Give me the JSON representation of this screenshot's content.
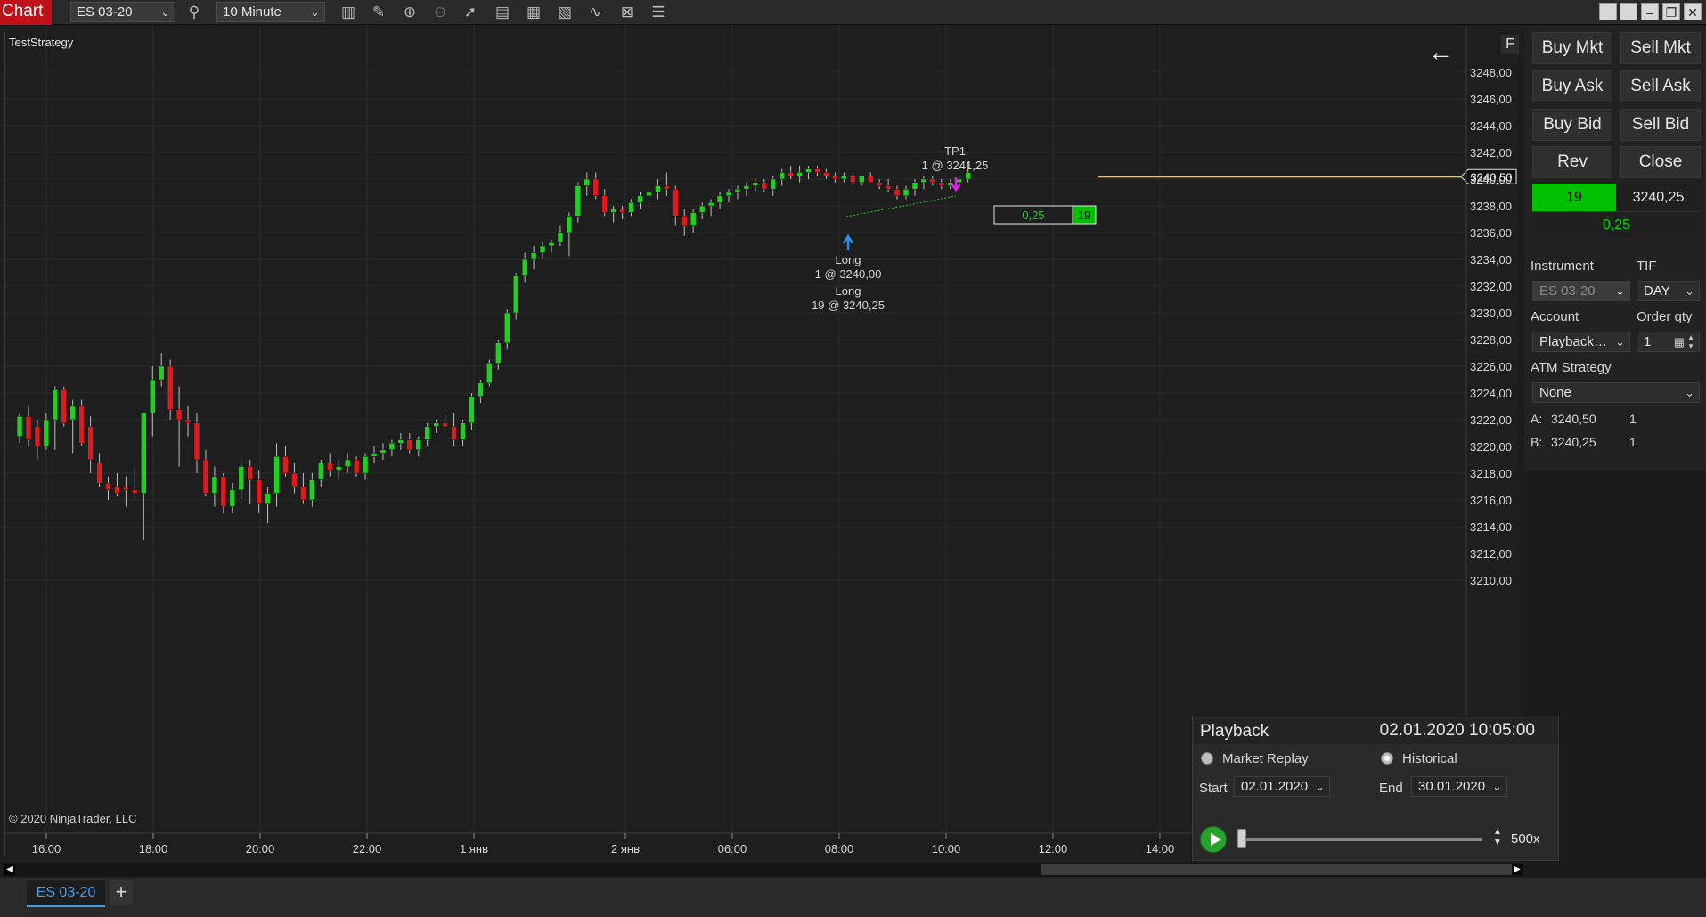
{
  "toolbar": {
    "app_label": "Chart",
    "instrument": "ES 03-20",
    "interval": "10 Minute",
    "tools": [
      "search-icon",
      "bars-type-icon",
      "drawing-tools-icon",
      "zoom-in-icon",
      "zoom-out-icon",
      "pointer-icon",
      "data-box-icon",
      "templates-icon",
      "properties-icon",
      "indicators-icon",
      "strategies-icon",
      "list-icon"
    ]
  },
  "chart": {
    "strategy_label": "TestStrategy",
    "copyright": "© 2020 NinjaTrader, LLC",
    "back_arrow": "←",
    "f_label": "F",
    "current_price_label": "3240,50",
    "position_widget": {
      "pnl": "0,25",
      "qty": "19"
    },
    "annotations": {
      "tp1_name": "TP1",
      "tp1_fill": "1 @ 3241,25",
      "entry1_name": "Long",
      "entry1_fill": "1 @ 3240,00",
      "entry2_name": "Long",
      "entry2_fill": "19 @ 3240,25"
    }
  },
  "chart_data": {
    "type": "candlestick",
    "instrument": "ES 03-20",
    "interval": "10 Minute",
    "x_ticks": [
      "16:00",
      "18:00",
      "20:00",
      "22:00",
      "1 янв",
      "2 янв",
      "06:00",
      "08:00",
      "10:00",
      "12:00",
      "14:00"
    ],
    "y_ticks": [
      "3248,00",
      "3246,00",
      "3244,00",
      "3242,00",
      "3240,00",
      "3238,00",
      "3236,00",
      "3234,00",
      "3232,00",
      "3230,00",
      "3228,00",
      "3226,00",
      "3224,00",
      "3222,00",
      "3220,00",
      "3218,00",
      "3216,00",
      "3214,00",
      "3212,00",
      "3210,00"
    ],
    "ylim": [
      3209.5,
      3250.5
    ],
    "grid": true,
    "candles": [
      [
        3220.75,
        3222.5,
        3220.25,
        3222.25
      ],
      [
        3222.25,
        3223,
        3220,
        3220.5
      ],
      [
        3221.5,
        3222,
        3219,
        3220
      ],
      [
        3220,
        3222.5,
        3219.75,
        3222
      ],
      [
        3222,
        3224.5,
        3219.75,
        3224.25
      ],
      [
        3224.25,
        3224.5,
        3221.5,
        3221.75
      ],
      [
        3222,
        3223.5,
        3219.5,
        3223
      ],
      [
        3223,
        3223.5,
        3220,
        3220.25
      ],
      [
        3221.5,
        3222.25,
        3218,
        3219
      ],
      [
        3218.75,
        3219.5,
        3217,
        3217.25
      ],
      [
        3217.25,
        3217.75,
        3216,
        3216.75
      ],
      [
        3217,
        3218,
        3216.25,
        3216.5
      ],
      [
        3217,
        3217.75,
        3215.5,
        3216.75
      ],
      [
        3216.75,
        3218.5,
        3216,
        3216.5
      ],
      [
        3216.5,
        3222.5,
        3213,
        3222.5
      ],
      [
        3222.5,
        3226,
        3220.75,
        3225
      ],
      [
        3225,
        3227,
        3224.5,
        3226
      ],
      [
        3226,
        3226.5,
        3222,
        3222.75
      ],
      [
        3222.75,
        3224.5,
        3218.5,
        3222
      ],
      [
        3222,
        3223,
        3220.75,
        3221.75
      ],
      [
        3221.75,
        3222.5,
        3218,
        3219
      ],
      [
        3219,
        3219.75,
        3216.25,
        3216.5
      ],
      [
        3216.5,
        3218.5,
        3215.5,
        3217.75
      ],
      [
        3217.75,
        3218,
        3215,
        3215.5
      ],
      [
        3215.5,
        3217.25,
        3215,
        3216.75
      ],
      [
        3216.75,
        3219,
        3216,
        3218.5
      ],
      [
        3218.5,
        3219,
        3215.75,
        3217.5
      ],
      [
        3217.5,
        3218.25,
        3215,
        3215.75
      ],
      [
        3215.75,
        3217,
        3214.25,
        3216.5
      ],
      [
        3216.5,
        3220.25,
        3215.5,
        3219.25
      ],
      [
        3219.25,
        3220,
        3217.75,
        3218
      ],
      [
        3218,
        3218.75,
        3216.5,
        3217
      ],
      [
        3217,
        3218,
        3215.75,
        3216
      ],
      [
        3216,
        3218,
        3215.5,
        3217.5
      ],
      [
        3217.5,
        3219,
        3217,
        3218.75
      ],
      [
        3218.75,
        3219.5,
        3217.75,
        3218.25
      ],
      [
        3218.25,
        3219,
        3217.5,
        3218.5
      ],
      [
        3218.5,
        3219.5,
        3218,
        3219
      ],
      [
        3219,
        3219.25,
        3217.75,
        3218
      ],
      [
        3218,
        3219.5,
        3217.5,
        3219.25
      ],
      [
        3219.25,
        3220,
        3218.75,
        3219.5
      ],
      [
        3219.5,
        3220.25,
        3219,
        3219.75
      ],
      [
        3219.75,
        3220.5,
        3219.25,
        3220.25
      ],
      [
        3220.25,
        3221,
        3219.75,
        3220.5
      ],
      [
        3220.5,
        3221,
        3219.5,
        3219.75
      ],
      [
        3219.75,
        3220.75,
        3219.25,
        3220.5
      ],
      [
        3220.5,
        3221.75,
        3220,
        3221.5
      ],
      [
        3221.5,
        3222,
        3221,
        3221.75
      ],
      [
        3221.75,
        3222.5,
        3221.25,
        3221.5
      ],
      [
        3221.5,
        3222.5,
        3220,
        3220.5
      ],
      [
        3220.5,
        3222,
        3220,
        3221.75
      ],
      [
        3221.75,
        3224,
        3221.25,
        3223.75
      ],
      [
        3223.75,
        3225,
        3223.25,
        3224.75
      ],
      [
        3224.75,
        3226.5,
        3224.5,
        3226.25
      ],
      [
        3226.25,
        3228,
        3225.75,
        3227.75
      ],
      [
        3227.75,
        3230.25,
        3227.25,
        3230
      ],
      [
        3230,
        3233,
        3229.5,
        3232.75
      ],
      [
        3232.75,
        3234.5,
        3232.25,
        3234
      ],
      [
        3234,
        3235,
        3233.25,
        3234.5
      ],
      [
        3234.5,
        3235.25,
        3234,
        3235
      ],
      [
        3235,
        3235.5,
        3234.5,
        3235.25
      ],
      [
        3235.25,
        3236.5,
        3235,
        3236
      ],
      [
        3236,
        3237.5,
        3234.25,
        3237.25
      ],
      [
        3237.25,
        3239.75,
        3236.75,
        3239.5
      ],
      [
        3239.5,
        3240.5,
        3238.75,
        3240
      ],
      [
        3240,
        3240.5,
        3238.5,
        3238.75
      ],
      [
        3238.75,
        3239.25,
        3237.25,
        3237.5
      ],
      [
        3237.5,
        3238,
        3236.75,
        3237.75
      ],
      [
        3237.75,
        3238,
        3237,
        3237.5
      ],
      [
        3237.5,
        3238.5,
        3237.25,
        3238.25
      ],
      [
        3238.25,
        3239,
        3237.75,
        3238.75
      ],
      [
        3238.75,
        3239.25,
        3238.25,
        3239
      ],
      [
        3239,
        3240,
        3238.5,
        3239.5
      ],
      [
        3239.5,
        3240.5,
        3238.75,
        3239.25
      ],
      [
        3239.25,
        3239.5,
        3236.5,
        3237.25
      ],
      [
        3237.25,
        3237.75,
        3235.75,
        3236.5
      ],
      [
        3236.5,
        3237.75,
        3236,
        3237.5
      ],
      [
        3237.5,
        3238.25,
        3237,
        3238
      ],
      [
        3238,
        3238.5,
        3237.25,
        3238.25
      ],
      [
        3238.25,
        3239,
        3237.75,
        3238.75
      ],
      [
        3238.75,
        3239.25,
        3238.25,
        3239
      ],
      [
        3239,
        3239.5,
        3238.5,
        3239.25
      ],
      [
        3239.25,
        3239.75,
        3238.75,
        3239.5
      ],
      [
        3239.5,
        3240,
        3239,
        3239.75
      ],
      [
        3239.75,
        3240,
        3239,
        3239.25
      ],
      [
        3239.25,
        3240.25,
        3238.75,
        3240
      ],
      [
        3240,
        3240.75,
        3239.5,
        3240.5
      ],
      [
        3240.5,
        3241,
        3240,
        3240.25
      ],
      [
        3240.25,
        3241,
        3239.75,
        3240.5
      ],
      [
        3240.5,
        3241,
        3240,
        3240.75
      ],
      [
        3240.75,
        3241,
        3240.25,
        3240.5
      ],
      [
        3240.5,
        3240.75,
        3240,
        3240.25
      ],
      [
        3240.25,
        3240.5,
        3239.75,
        3240
      ],
      [
        3240,
        3240.5,
        3239.75,
        3240.25
      ],
      [
        3240.25,
        3240.5,
        3239.5,
        3239.75
      ],
      [
        3239.75,
        3240.25,
        3239.5,
        3240.25
      ],
      [
        3240.25,
        3240.5,
        3239.75,
        3239.75
      ],
      [
        3239.75,
        3240,
        3239.25,
        3239.5
      ],
      [
        3239.5,
        3240,
        3239,
        3239.25
      ],
      [
        3239.25,
        3239.5,
        3238.5,
        3238.75
      ],
      [
        3238.75,
        3239.5,
        3238.5,
        3239.25
      ],
      [
        3239.25,
        3240,
        3238.75,
        3239.75
      ],
      [
        3239.75,
        3240.25,
        3239.25,
        3240
      ],
      [
        3240,
        3240.25,
        3239.5,
        3239.75
      ],
      [
        3239.75,
        3240,
        3239.25,
        3239.5
      ],
      [
        3239.5,
        3240,
        3239.25,
        3239.75
      ],
      [
        3239.75,
        3240.25,
        3239.5,
        3240
      ],
      [
        3240,
        3241.25,
        3239.75,
        3240.5
      ]
    ]
  },
  "order_entry": {
    "buttons": [
      {
        "id": "buy-mkt",
        "label": "Buy Mkt"
      },
      {
        "id": "sell-mkt",
        "label": "Sell Mkt"
      },
      {
        "id": "buy-ask",
        "label": "Buy Ask"
      },
      {
        "id": "sell-ask",
        "label": "Sell Ask"
      },
      {
        "id": "buy-bid",
        "label": "Buy Bid"
      },
      {
        "id": "sell-bid",
        "label": "Sell Bid"
      },
      {
        "id": "rev",
        "label": "Rev"
      },
      {
        "id": "close",
        "label": "Close"
      }
    ],
    "position_qty": "19",
    "position_price": "3240,25",
    "position_pnl": "0,25",
    "instrument_label": "Instrument",
    "instrument_value": "ES 03-20",
    "tif_label": "TIF",
    "tif_value": "DAY",
    "account_label": "Account",
    "account_value": "Playback…",
    "order_qty_label": "Order qty",
    "order_qty_value": "1",
    "atm_label": "ATM Strategy",
    "atm_value": "None",
    "ask_label": "A:",
    "ask_price": "3240,50",
    "ask_size": "1",
    "bid_label": "B:",
    "bid_price": "3240,25",
    "bid_size": "1"
  },
  "playback": {
    "title": "Playback",
    "current_time": "02.01.2020 10:05:00",
    "market_replay_label": "Market Replay",
    "historical_label": "Historical",
    "start_label": "Start",
    "start_value": "02.01.2020",
    "end_label": "End",
    "end_value": "30.01.2020",
    "speed": "500x"
  },
  "tabs": {
    "active": "ES 03-20",
    "add": "+"
  },
  "colors": {
    "up_candle": "#1fd11f",
    "down_candle": "#e0191f",
    "accent_red": "#c0101a",
    "position_green": "#00c000",
    "tab_blue": "#3f9de8"
  }
}
